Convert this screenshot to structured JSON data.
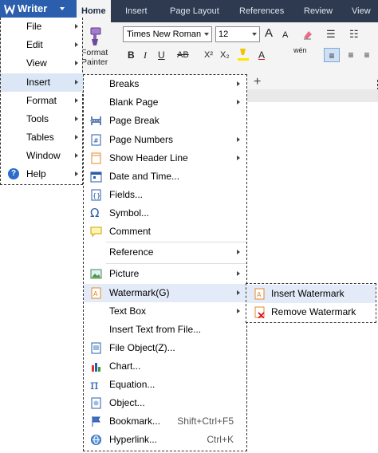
{
  "app": {
    "name": "Writer",
    "accent": "#2b5fad"
  },
  "ribbon": {
    "tabs": [
      "Home",
      "Insert",
      "Page Layout",
      "References",
      "Review",
      "View"
    ],
    "active_tab": "Home",
    "format_painter_label_1": "Format",
    "format_painter_label_2": "Painter",
    "font_name": "Times New Roman",
    "font_size": "12",
    "buttons": [
      "A",
      "A",
      "B",
      "I",
      "U",
      "AB",
      "X²",
      "X₂",
      "A",
      "wén"
    ],
    "new_tab": "+"
  },
  "main_menu": {
    "items": [
      {
        "label": "File",
        "submenu": true
      },
      {
        "label": "Edit",
        "submenu": true
      },
      {
        "label": "View",
        "submenu": true
      },
      {
        "label": "Insert",
        "submenu": true,
        "highlighted": true
      },
      {
        "label": "Format",
        "submenu": true
      },
      {
        "label": "Tools",
        "submenu": true
      },
      {
        "label": "Tables",
        "submenu": true
      },
      {
        "label": "Window",
        "submenu": true
      },
      {
        "label": "Help",
        "submenu": true,
        "icon": "help-icon"
      }
    ]
  },
  "insert_menu": {
    "items": [
      {
        "label": "Breaks",
        "submenu": true,
        "icon": ""
      },
      {
        "label": "Blank Page",
        "submenu": true,
        "icon": ""
      },
      {
        "label": "Page Break",
        "submenu": false,
        "icon": "page-break-icon"
      },
      {
        "label": "Page Numbers",
        "submenu": true,
        "icon": "page-numbers-icon"
      },
      {
        "label": "Show Header Line",
        "submenu": true,
        "icon": "header-line-icon"
      },
      {
        "label": "Date and Time...",
        "submenu": false,
        "icon": "calendar-icon"
      },
      {
        "label": "Fields...",
        "submenu": false,
        "icon": "fields-icon"
      },
      {
        "label": "Symbol...",
        "submenu": false,
        "icon": "omega-icon"
      },
      {
        "label": "Comment",
        "submenu": false,
        "icon": "comment-icon"
      },
      {
        "label": "Reference",
        "submenu": true,
        "icon": ""
      },
      {
        "label": "Picture",
        "submenu": true,
        "icon": "picture-icon"
      },
      {
        "label": "Watermark(G)",
        "submenu": true,
        "icon": "watermark-icon",
        "highlighted": true
      },
      {
        "label": "Text Box",
        "submenu": true,
        "icon": ""
      },
      {
        "label": "Insert Text from File...",
        "submenu": false,
        "icon": ""
      },
      {
        "label": "File Object(Z)...",
        "submenu": false,
        "icon": "file-object-icon"
      },
      {
        "label": "Chart...",
        "submenu": false,
        "icon": "chart-icon"
      },
      {
        "label": "Equation...",
        "submenu": false,
        "icon": "pi-icon"
      },
      {
        "label": "Object...",
        "submenu": false,
        "icon": "object-icon"
      },
      {
        "label": "Bookmark...",
        "submenu": false,
        "icon": "bookmark-icon",
        "shortcut": "Shift+Ctrl+F5"
      },
      {
        "label": "Hyperlink...",
        "submenu": false,
        "icon": "hyperlink-icon",
        "shortcut": "Ctrl+K"
      }
    ]
  },
  "watermark_menu": {
    "items": [
      {
        "label": "Insert Watermark",
        "icon": "insert-watermark-icon",
        "highlighted": true
      },
      {
        "label": "Remove Watermark",
        "icon": "remove-watermark-icon"
      }
    ]
  }
}
